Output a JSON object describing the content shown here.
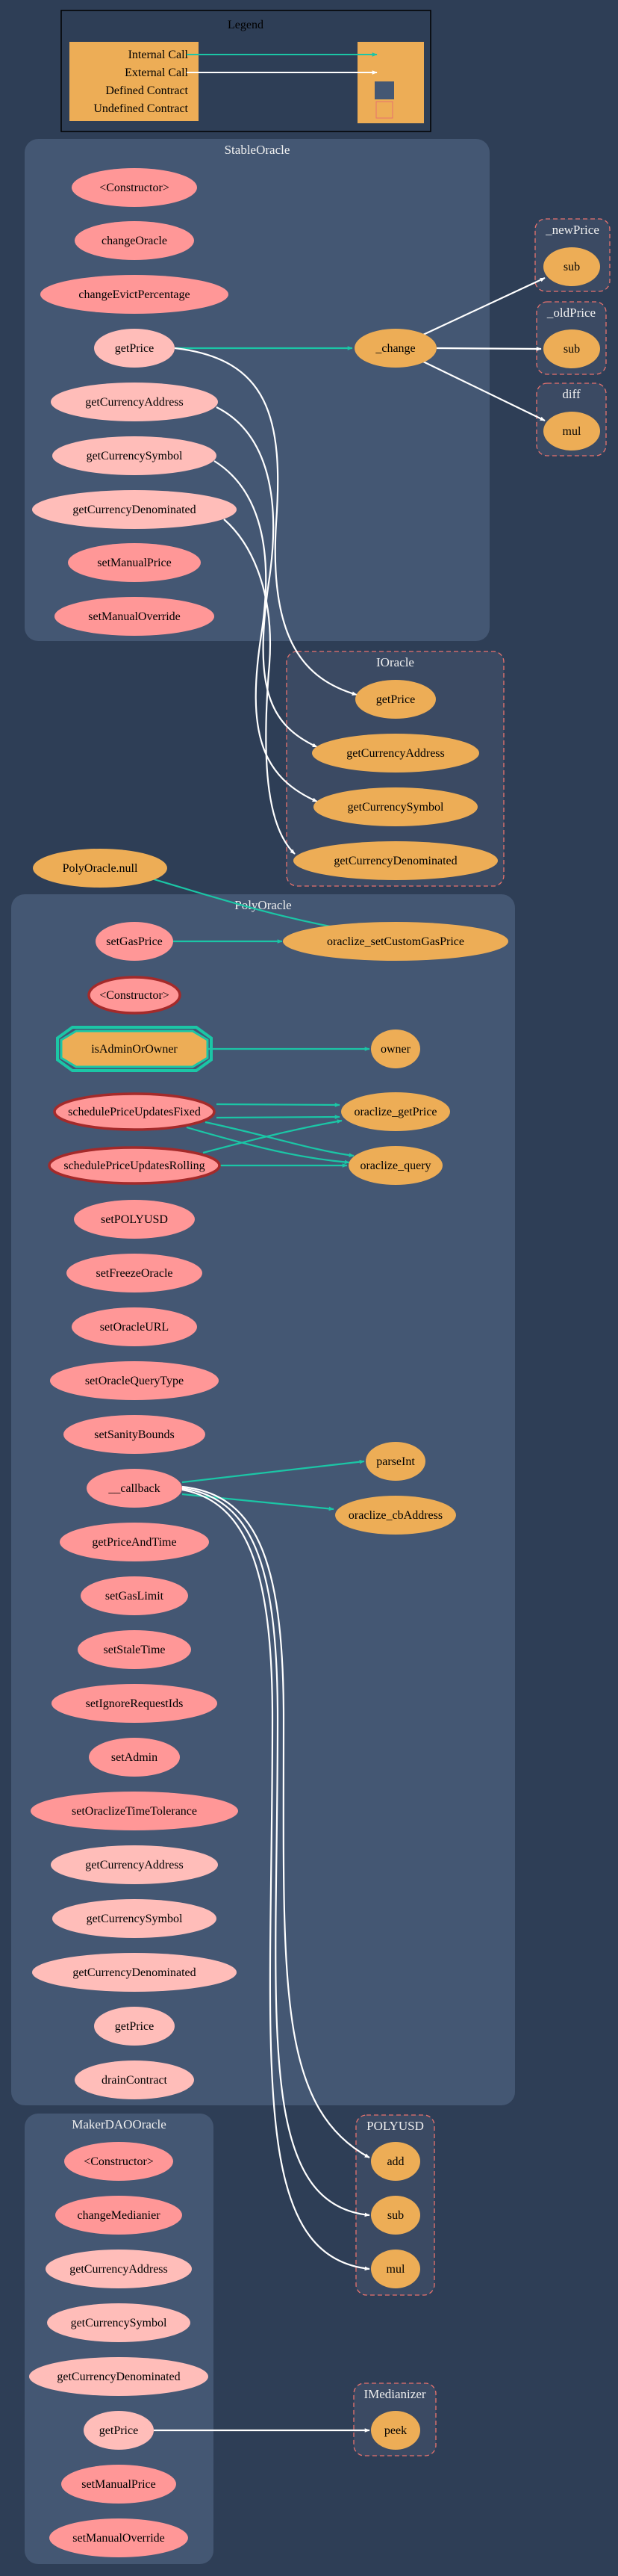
{
  "colors": {
    "background": "#2e3e56",
    "cluster_defined": "#445773",
    "cluster_undefined": "#3b4a63",
    "undefined_border": "#e8726d",
    "internal_call": "#1bc6a6",
    "external_call": "#ffffff",
    "public_fn": "#ffbdb9",
    "private_fn": "#ff9797",
    "external_node": "#edad56",
    "modifier_border": "#1bc6a6",
    "constructor_border": "#a42a2a",
    "cluster_label": "#f0f0f0"
  },
  "legend": {
    "title": "Legend",
    "items": [
      "Internal Call",
      "External Call",
      "Defined Contract",
      "Undefined Contract"
    ]
  },
  "clusters": [
    {
      "id": "StableOracle",
      "label": "StableOracle",
      "kind": "defined"
    },
    {
      "id": "_newPrice",
      "label": "_newPrice",
      "kind": "undefined"
    },
    {
      "id": "_oldPrice",
      "label": "_oldPrice",
      "kind": "undefined"
    },
    {
      "id": "diff",
      "label": "diff",
      "kind": "undefined"
    },
    {
      "id": "IOracle",
      "label": "IOracle",
      "kind": "undefined"
    },
    {
      "id": "PolyOracle",
      "label": "PolyOracle",
      "kind": "defined"
    },
    {
      "id": "MakerDAOOracle",
      "label": "MakerDAOOracle",
      "kind": "defined"
    },
    {
      "id": "POLYUSD",
      "label": "POLYUSD",
      "kind": "undefined"
    },
    {
      "id": "IMedianizer",
      "label": "IMedianizer",
      "kind": "undefined"
    }
  ],
  "nodes": [
    {
      "id": "so_ctor",
      "label": "<Constructor>",
      "style": "private"
    },
    {
      "id": "so_changeOracle",
      "label": "changeOracle",
      "style": "private"
    },
    {
      "id": "so_changeEvict",
      "label": "changeEvictPercentage",
      "style": "private"
    },
    {
      "id": "so_getPrice",
      "label": "getPrice",
      "style": "public"
    },
    {
      "id": "so_getCurAddr",
      "label": "getCurrencyAddress",
      "style": "public"
    },
    {
      "id": "so_getCurSym",
      "label": "getCurrencySymbol",
      "style": "public"
    },
    {
      "id": "so_getCurDen",
      "label": "getCurrencyDenominated",
      "style": "public"
    },
    {
      "id": "so_setManualPrice",
      "label": "setManualPrice",
      "style": "private"
    },
    {
      "id": "so_setManualOverride",
      "label": "setManualOverride",
      "style": "private"
    },
    {
      "id": "so_change",
      "label": "_change",
      "style": "external"
    },
    {
      "id": "np_sub",
      "label": "sub",
      "style": "external"
    },
    {
      "id": "op_sub",
      "label": "sub",
      "style": "external"
    },
    {
      "id": "diff_mul",
      "label": "mul",
      "style": "external"
    },
    {
      "id": "io_getPrice",
      "label": "getPrice",
      "style": "external"
    },
    {
      "id": "io_getCurAddr",
      "label": "getCurrencyAddress",
      "style": "external"
    },
    {
      "id": "io_getCurSym",
      "label": "getCurrencySymbol",
      "style": "external"
    },
    {
      "id": "io_getCurDen",
      "label": "getCurrencyDenominated",
      "style": "external"
    },
    {
      "id": "po_null",
      "label": "PolyOracle.null",
      "style": "external"
    },
    {
      "id": "po_setGasPrice",
      "label": "setGasPrice",
      "style": "private"
    },
    {
      "id": "po_oraclizeSetGas",
      "label": "oraclize_setCustomGasPrice",
      "style": "external"
    },
    {
      "id": "po_ctor",
      "label": "<Constructor>",
      "style": "constructor"
    },
    {
      "id": "po_isAdminOrOwner",
      "label": "isAdminOrOwner",
      "style": "modifier"
    },
    {
      "id": "po_owner",
      "label": "owner",
      "style": "external"
    },
    {
      "id": "po_schedFixed",
      "label": "schedulePriceUpdatesFixed",
      "style": "constructor"
    },
    {
      "id": "po_oraclizeGetPrice",
      "label": "oraclize_getPrice",
      "style": "external"
    },
    {
      "id": "po_schedRolling",
      "label": "schedulePriceUpdatesRolling",
      "style": "constructor"
    },
    {
      "id": "po_oraclizeQuery",
      "label": "oraclize_query",
      "style": "external"
    },
    {
      "id": "po_setPOLYUSD",
      "label": "setPOLYUSD",
      "style": "private"
    },
    {
      "id": "po_setFreeze",
      "label": "setFreezeOracle",
      "style": "private"
    },
    {
      "id": "po_setURL",
      "label": "setOracleURL",
      "style": "private"
    },
    {
      "id": "po_setQueryType",
      "label": "setOracleQueryType",
      "style": "private"
    },
    {
      "id": "po_setSanity",
      "label": "setSanityBounds",
      "style": "private"
    },
    {
      "id": "po_parseInt",
      "label": "parseInt",
      "style": "external"
    },
    {
      "id": "po_callback",
      "label": "__callback",
      "style": "private"
    },
    {
      "id": "po_cbAddress",
      "label": "oraclize_cbAddress",
      "style": "external"
    },
    {
      "id": "po_getPriceAndTime",
      "label": "getPriceAndTime",
      "style": "private"
    },
    {
      "id": "po_setGasLimit",
      "label": "setGasLimit",
      "style": "private"
    },
    {
      "id": "po_setStaleTime",
      "label": "setStaleTime",
      "style": "private"
    },
    {
      "id": "po_setIgnore",
      "label": "setIgnoreRequestIds",
      "style": "private"
    },
    {
      "id": "po_setAdmin",
      "label": "setAdmin",
      "style": "private"
    },
    {
      "id": "po_setTolerance",
      "label": "setOraclizeTimeTolerance",
      "style": "private"
    },
    {
      "id": "po_getCurAddr",
      "label": "getCurrencyAddress",
      "style": "public"
    },
    {
      "id": "po_getCurSym",
      "label": "getCurrencySymbol",
      "style": "public"
    },
    {
      "id": "po_getCurDen",
      "label": "getCurrencyDenominated",
      "style": "public"
    },
    {
      "id": "po_getPrice",
      "label": "getPrice",
      "style": "public"
    },
    {
      "id": "po_drain",
      "label": "drainContract",
      "style": "public"
    },
    {
      "id": "md_ctor",
      "label": "<Constructor>",
      "style": "private"
    },
    {
      "id": "md_changeMed",
      "label": "changeMedianier",
      "style": "private"
    },
    {
      "id": "md_getCurAddr",
      "label": "getCurrencyAddress",
      "style": "public"
    },
    {
      "id": "md_getCurSym",
      "label": "getCurrencySymbol",
      "style": "public"
    },
    {
      "id": "md_getCurDen",
      "label": "getCurrencyDenominated",
      "style": "public"
    },
    {
      "id": "md_getPrice",
      "label": "getPrice",
      "style": "public"
    },
    {
      "id": "md_setManualPrice",
      "label": "setManualPrice",
      "style": "private"
    },
    {
      "id": "md_setManualOverride",
      "label": "setManualOverride",
      "style": "private"
    },
    {
      "id": "pu_add",
      "label": "add",
      "style": "external"
    },
    {
      "id": "pu_sub",
      "label": "sub",
      "style": "external"
    },
    {
      "id": "pu_mul",
      "label": "mul",
      "style": "external"
    },
    {
      "id": "im_peek",
      "label": "peek",
      "style": "external"
    }
  ],
  "edges": [
    {
      "from": "so_getPrice",
      "to": "so_change",
      "type": "internal"
    },
    {
      "from": "so_change",
      "to": "np_sub",
      "type": "external"
    },
    {
      "from": "so_change",
      "to": "op_sub",
      "type": "external"
    },
    {
      "from": "so_change",
      "to": "diff_mul",
      "type": "external"
    },
    {
      "from": "so_getPrice",
      "to": "io_getPrice",
      "type": "external"
    },
    {
      "from": "so_getCurAddr",
      "to": "io_getCurAddr",
      "type": "external"
    },
    {
      "from": "so_getCurSym",
      "to": "io_getCurSym",
      "type": "external"
    },
    {
      "from": "so_getCurDen",
      "to": "io_getCurDen",
      "type": "external"
    },
    {
      "from": "po_null",
      "to": "po_oraclizeSetGas",
      "type": "internal"
    },
    {
      "from": "po_setGasPrice",
      "to": "po_oraclizeSetGas",
      "type": "internal"
    },
    {
      "from": "po_isAdminOrOwner",
      "to": "po_owner",
      "type": "internal"
    },
    {
      "from": "po_schedFixed",
      "to": "po_oraclizeGetPrice",
      "type": "internal"
    },
    {
      "from": "po_schedFixed",
      "to": "po_oraclizeGetPrice",
      "type": "internal"
    },
    {
      "from": "po_schedFixed",
      "to": "po_oraclizeQuery",
      "type": "internal"
    },
    {
      "from": "po_schedFixed",
      "to": "po_oraclizeQuery",
      "type": "internal"
    },
    {
      "from": "po_schedRolling",
      "to": "po_oraclizeGetPrice",
      "type": "internal"
    },
    {
      "from": "po_schedRolling",
      "to": "po_oraclizeQuery",
      "type": "internal"
    },
    {
      "from": "po_callback",
      "to": "po_parseInt",
      "type": "internal"
    },
    {
      "from": "po_callback",
      "to": "po_cbAddress",
      "type": "internal"
    },
    {
      "from": "po_callback",
      "to": "pu_add",
      "type": "external"
    },
    {
      "from": "po_callback",
      "to": "pu_sub",
      "type": "external"
    },
    {
      "from": "po_callback",
      "to": "pu_mul",
      "type": "external"
    },
    {
      "from": "md_getPrice",
      "to": "im_peek",
      "type": "external"
    }
  ]
}
